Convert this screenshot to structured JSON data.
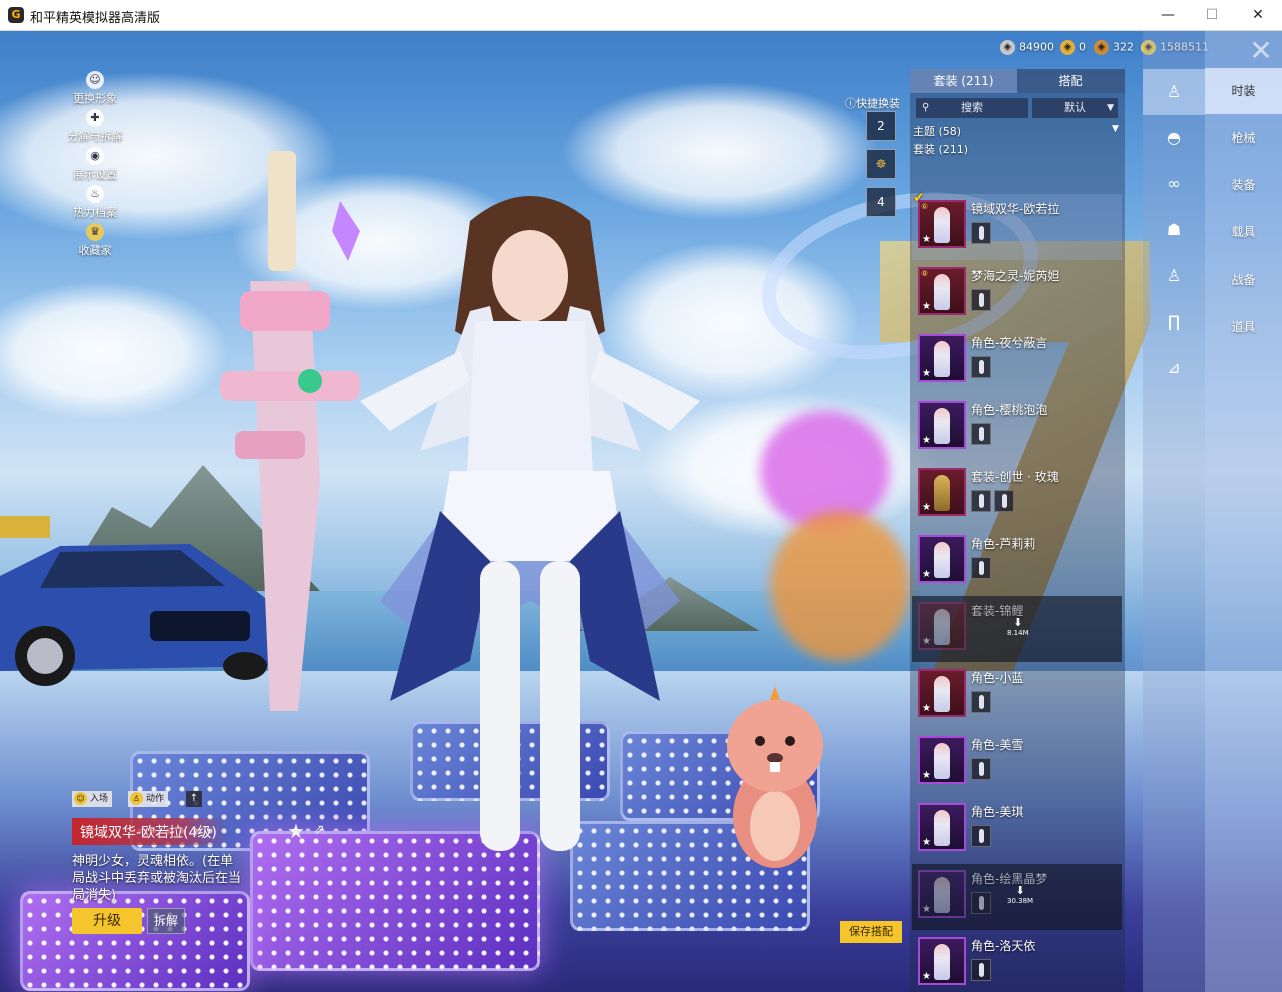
{
  "window": {
    "title": "和平精英模拟器高清版",
    "icon_letter": "G",
    "controls": {
      "minimize": "—",
      "maximize": "☐",
      "close": "✕"
    }
  },
  "left_menu": [
    {
      "label": "更换形象",
      "icon": "person-icon"
    },
    {
      "label": "分解与拆解",
      "icon": "puzzle-icon"
    },
    {
      "label": "展示设置",
      "icon": "eye-icon"
    },
    {
      "label": "热力档案",
      "icon": "flame-icon"
    },
    {
      "label": "收藏家",
      "icon": "trophy-icon"
    }
  ],
  "currency": [
    {
      "value": "84900",
      "icon": "silver-coin-icon",
      "color": "#c9c9c9"
    },
    {
      "value": "0",
      "icon": "gold-coin-icon",
      "color": "#e3b23c"
    },
    {
      "value": "322",
      "icon": "bronze-coin-icon",
      "color": "#d08a3a"
    },
    {
      "value": "1588511",
      "icon": "uc-coin-icon",
      "color": "#f5d44a"
    }
  ],
  "close_label": "✕",
  "quick_change": {
    "label": "快捷换装",
    "slots": [
      "2",
      "",
      "4"
    ]
  },
  "panel": {
    "tabs": [
      "套装 (211)",
      "搭配"
    ],
    "search_placeholder": "搜索",
    "sort_label": "默认",
    "theme_label": "主题 (58)",
    "set_label": "套装 (211)",
    "outfits": [
      {
        "name": "镜域双华-欧若拉",
        "state": "selected",
        "checked": true
      },
      {
        "name": "梦海之灵-妮芮妲",
        "state": "normal"
      },
      {
        "name": "角色-夜兮蔽言",
        "state": "normal"
      },
      {
        "name": "角色-樱桃泡泡",
        "state": "normal"
      },
      {
        "name": "套装-创世 · 玫瑰",
        "state": "normal"
      },
      {
        "name": "角色-芦莉莉",
        "state": "normal"
      },
      {
        "name": "套装-锦鲤",
        "state": "locked",
        "download": "8.14M"
      },
      {
        "name": "角色-小蓝",
        "state": "normal"
      },
      {
        "name": "角色-美雪",
        "state": "normal"
      },
      {
        "name": "角色-美琪",
        "state": "normal"
      },
      {
        "name": "角色-绘黑晶梦",
        "state": "locked",
        "download": "30.38M"
      },
      {
        "name": "角色-洛天依",
        "state": "normal"
      }
    ]
  },
  "categories": [
    "时装",
    "枪械",
    "装备",
    "载具",
    "战备",
    "道具"
  ],
  "category_icons": [
    "figure-icon",
    "cap-icon",
    "goggles-icon",
    "mask-icon",
    "figure-pose-icon",
    "pants-icon",
    "boots-icon"
  ],
  "bottom_info": {
    "mode_labels": [
      "入场",
      "动作"
    ],
    "item_name": "镜域双华-欧若拉(4级)",
    "description": "神明少女，灵魂相依。(在单局战斗中丢弃或被淘汰后在当局消失)",
    "upgrade_label": "升级",
    "dismantle_label": "拆解"
  },
  "save_outfit_label": "保存搭配"
}
